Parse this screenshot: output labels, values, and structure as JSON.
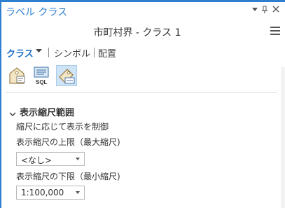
{
  "pane": {
    "title": "ラベル クラス",
    "controls": {
      "dropdown_icon": "triangle-down-icon",
      "pin_icon": "pin-icon",
      "close_icon": "close-icon"
    }
  },
  "layer": {
    "name": "市町村界 - クラス 1",
    "menu_icon": "hamburger-menu-icon"
  },
  "tabs": [
    {
      "label": "クラス",
      "active": true
    },
    {
      "label": "シンボル",
      "active": false
    },
    {
      "label": "配置",
      "active": false
    }
  ],
  "toolbar": [
    {
      "icon": "class-label-icon",
      "selected": false
    },
    {
      "icon": "sql-query-icon",
      "text": "SQL",
      "selected": false
    },
    {
      "icon": "visibility-range-icon",
      "selected": true
    }
  ],
  "section": {
    "title": "表示縮尺範囲",
    "description": "縮尺に応じて表示を制御",
    "upper_label": "表示縮尺の上限（最大縮尺)",
    "upper_value": "<なし>",
    "lower_label": "表示縮尺の下限（最小縮尺)",
    "lower_value": "1:100,000"
  },
  "colors": {
    "accent": "#2f7fd0",
    "selected_bg": "#cfe4f7"
  }
}
